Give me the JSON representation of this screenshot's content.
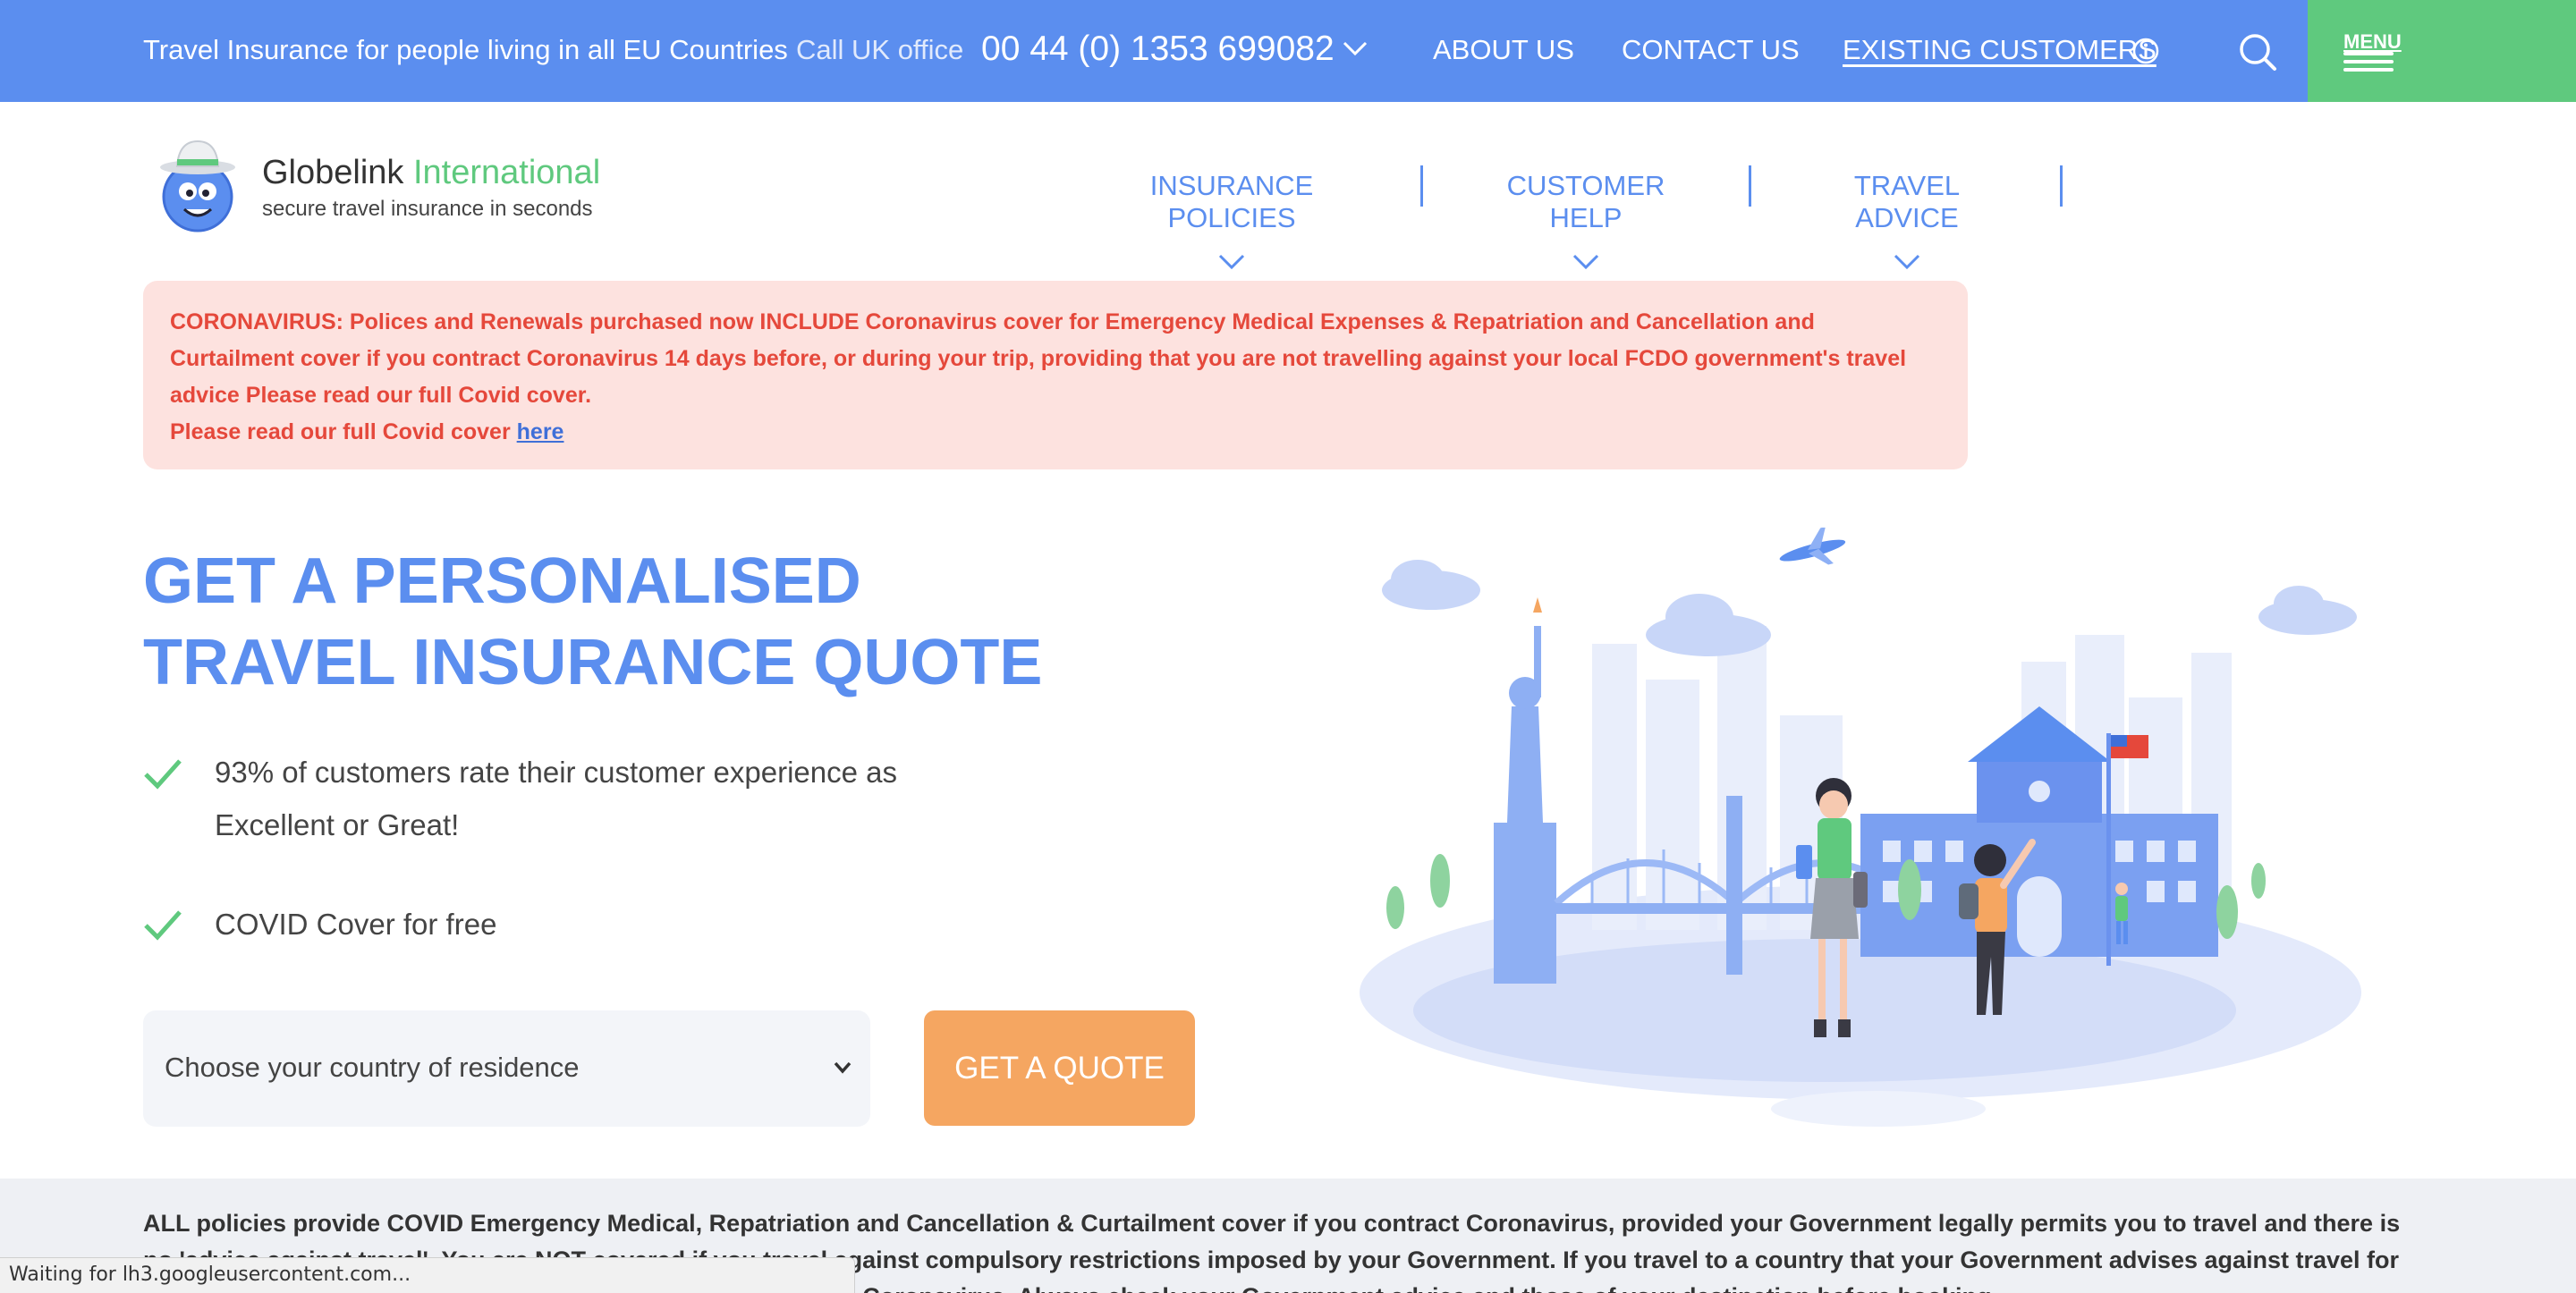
{
  "topbar": {
    "tagline": "Travel Insurance for people living in all EU Countries",
    "call_label": "Call UK office",
    "phone": "00 44 (0) 1353 699082",
    "about": "ABOUT US",
    "contact": "CONTACT US",
    "existing": "EXISTING CUSTOMERS",
    "menu": "MENU",
    "bg_color": "#5b8eef",
    "menu_color": "#5fc97e"
  },
  "header": {
    "logo_name_main": "Globelink",
    "logo_name_accent": "International",
    "logo_sub": "secure travel insurance in seconds",
    "nav": [
      "INSURANCE POLICIES",
      "CUSTOMER HELP",
      "TRAVEL ADVICE"
    ]
  },
  "alert": {
    "text": "CORONAVIRUS: Polices and Renewals purchased now INCLUDE Coronavirus cover for Emergency Medical Expenses & Repatriation and Cancellation and Curtailment cover if you contract Coronavirus 14 days before, or during your trip, providing that you are not travelling against your local FCDO government's travel advice Please read our full Covid cover.",
    "line2": "Please read our full Covid cover",
    "link": "here"
  },
  "hero": {
    "title_line1": "GET A PERSONALISED",
    "title_line2": "TRAVEL INSURANCE QUOTE",
    "bullets": [
      "93% of customers rate their customer experience as Excellent or Great!",
      "COVID Cover for free"
    ],
    "select_placeholder": "Choose your country of residence",
    "quote_button": "GET A QUOTE",
    "button_color": "#f5a661"
  },
  "disclaimer": "ALL policies provide COVID Emergency Medical, Repatriation and Cancellation & Curtailment cover if you contract Coronavirus, provided your Government legally permits you to travel and there is no 'advice against travel'. You are NOT covered if you travel against compulsory restrictions imposed by your Government. If you travel to a country that your Government advises against travel for any reason, your policy will NOT cover claims associated with Coronavirus. Always check your Government advice and those of your destination before booking.",
  "status_bar": "Waiting for lh3.googleusercontent.com..."
}
